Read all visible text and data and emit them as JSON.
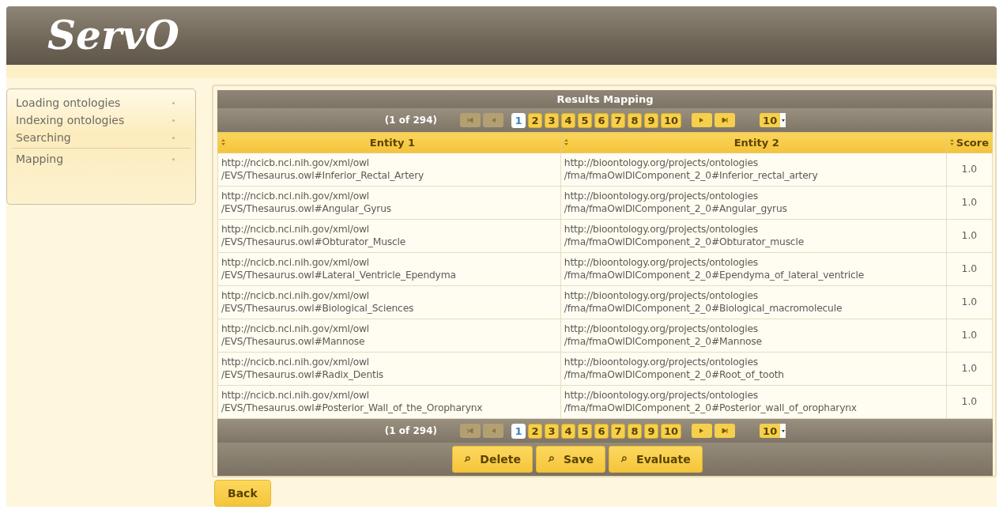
{
  "header": {
    "logo": "ServO"
  },
  "sidebar": {
    "items": [
      {
        "label": "Loading ontologies"
      },
      {
        "label": "Indexing ontologies"
      },
      {
        "label": "Searching"
      },
      {
        "label": "Mapping"
      }
    ]
  },
  "results": {
    "title": "Results Mapping",
    "paginators": [
      {
        "summary": "(1 of 294)",
        "pages": [
          {
            "label": "1",
            "selected": true
          },
          {
            "label": "2",
            "selected": false
          },
          {
            "label": "3",
            "selected": false
          },
          {
            "label": "4",
            "selected": false
          },
          {
            "label": "5",
            "selected": false
          },
          {
            "label": "6",
            "selected": false
          },
          {
            "label": "7",
            "selected": false
          },
          {
            "label": "8",
            "selected": false
          },
          {
            "label": "9",
            "selected": false
          },
          {
            "label": "10",
            "selected": false
          }
        ],
        "rows_per_page": "10"
      },
      {
        "summary": "(1 of 294)",
        "pages": [
          {
            "label": "1",
            "selected": true
          },
          {
            "label": "2",
            "selected": false
          },
          {
            "label": "3",
            "selected": false
          },
          {
            "label": "4",
            "selected": false
          },
          {
            "label": "5",
            "selected": false
          },
          {
            "label": "6",
            "selected": false
          },
          {
            "label": "7",
            "selected": false
          },
          {
            "label": "8",
            "selected": false
          },
          {
            "label": "9",
            "selected": false
          },
          {
            "label": "10",
            "selected": false
          }
        ],
        "rows_per_page": "10"
      }
    ],
    "columns": [
      "Entity 1",
      "Entity 2",
      "Score"
    ],
    "rows": [
      {
        "entity_1": [
          "http://ncicb.nci.nih.gov/xml/owl",
          "/EVS/Thesaurus.owl#Inferior_Rectal_Artery"
        ],
        "entity_2": [
          "http://bioontology.org/projects/ontologies",
          "/fma/fmaOwlDlComponent_2_0#Inferior_rectal_artery"
        ],
        "score": "1.0"
      },
      {
        "entity_1": [
          "http://ncicb.nci.nih.gov/xml/owl",
          "/EVS/Thesaurus.owl#Angular_Gyrus"
        ],
        "entity_2": [
          "http://bioontology.org/projects/ontologies",
          "/fma/fmaOwlDlComponent_2_0#Angular_gyrus"
        ],
        "score": "1.0"
      },
      {
        "entity_1": [
          "http://ncicb.nci.nih.gov/xml/owl",
          "/EVS/Thesaurus.owl#Obturator_Muscle"
        ],
        "entity_2": [
          "http://bioontology.org/projects/ontologies",
          "/fma/fmaOwlDlComponent_2_0#Obturator_muscle"
        ],
        "score": "1.0"
      },
      {
        "entity_1": [
          "http://ncicb.nci.nih.gov/xml/owl",
          "/EVS/Thesaurus.owl#Lateral_Ventricle_Ependyma"
        ],
        "entity_2": [
          "http://bioontology.org/projects/ontologies",
          "/fma/fmaOwlDlComponent_2_0#Ependyma_of_lateral_ventricle"
        ],
        "score": "1.0"
      },
      {
        "entity_1": [
          "http://ncicb.nci.nih.gov/xml/owl",
          "/EVS/Thesaurus.owl#Biological_Sciences"
        ],
        "entity_2": [
          "http://bioontology.org/projects/ontologies",
          "/fma/fmaOwlDlComponent_2_0#Biological_macromolecule"
        ],
        "score": "1.0"
      },
      {
        "entity_1": [
          "http://ncicb.nci.nih.gov/xml/owl",
          "/EVS/Thesaurus.owl#Mannose"
        ],
        "entity_2": [
          "http://bioontology.org/projects/ontologies",
          "/fma/fmaOwlDlComponent_2_0#Mannose"
        ],
        "score": "1.0"
      },
      {
        "entity_1": [
          "http://ncicb.nci.nih.gov/xml/owl",
          "/EVS/Thesaurus.owl#Radix_Dentis"
        ],
        "entity_2": [
          "http://bioontology.org/projects/ontologies",
          "/fma/fmaOwlDlComponent_2_0#Root_of_tooth"
        ],
        "score": "1.0"
      },
      {
        "entity_1": [
          "http://ncicb.nci.nih.gov/xml/owl",
          "/EVS/Thesaurus.owl#Posterior_Wall_of_the_Oropharynx"
        ],
        "entity_2": [
          "http://bioontology.org/projects/ontologies",
          "/fma/fmaOwlDlComponent_2_0#Posterior_wall_of_oropharynx"
        ],
        "score": "1.0"
      }
    ],
    "actions": [
      "Delete",
      "Save",
      "Evaluate"
    ]
  },
  "back_button": "Back"
}
